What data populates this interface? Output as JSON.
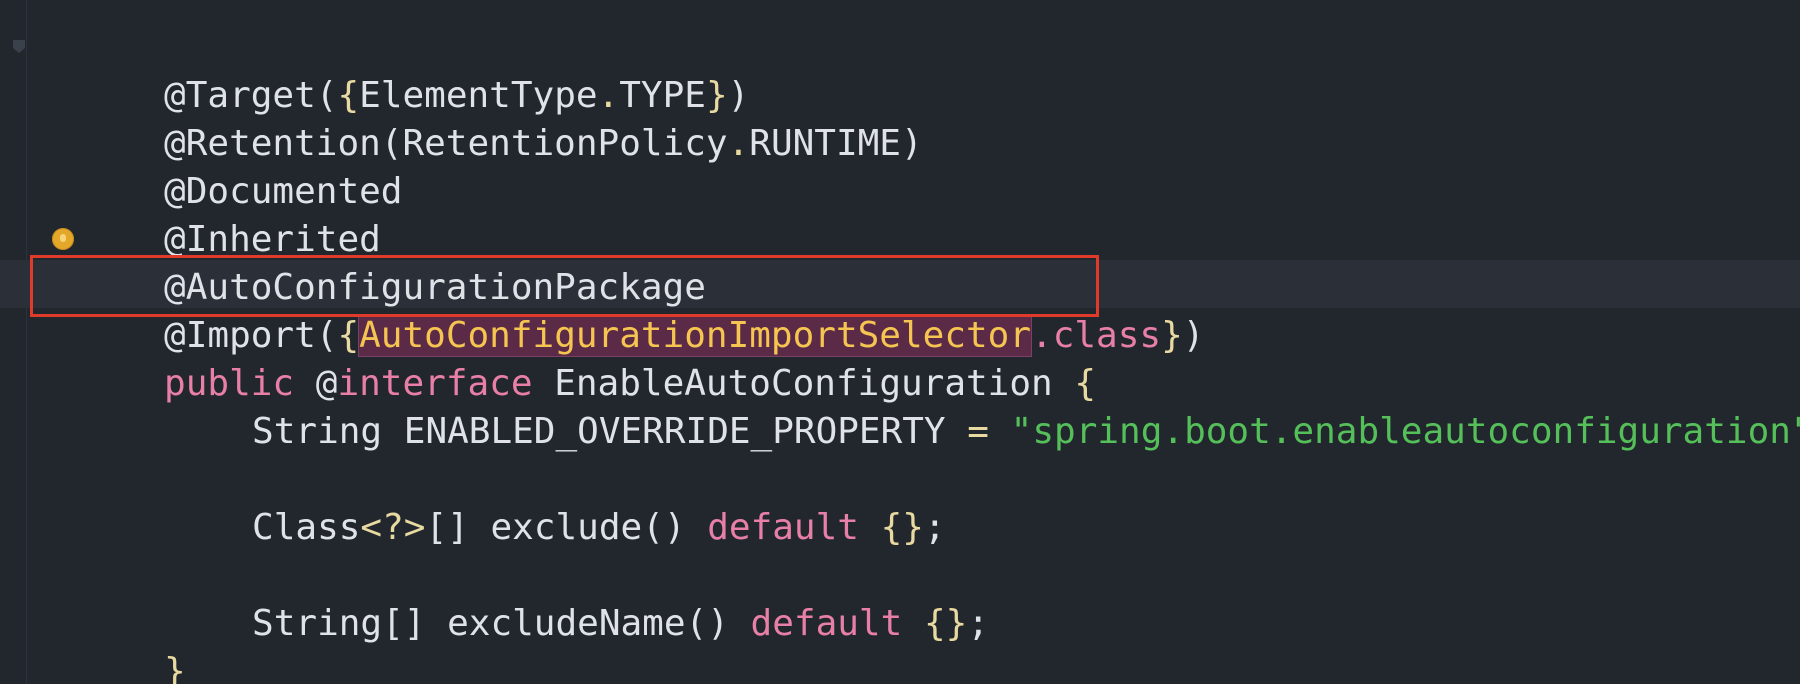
{
  "editor": {
    "lines": [
      {
        "parts": [
          "@Target(",
          "{",
          "ElementType",
          ".",
          "TYPE",
          "}",
          ")"
        ]
      },
      {
        "parts": [
          "@Retention(RetentionPolicy",
          ".",
          "RUNTIME)"
        ]
      },
      {
        "parts": [
          "@Documented"
        ]
      },
      {
        "parts": [
          "@Inherited"
        ]
      },
      {
        "parts": [
          "@AutoConfigurationPackage"
        ]
      },
      {
        "parts": [
          "@Import(",
          "{",
          "AutoConfigurationImportSelector",
          ".class",
          "}",
          ")"
        ]
      },
      {
        "parts": [
          "public",
          " @",
          "interface",
          " EnableAutoConfiguration ",
          "{"
        ]
      },
      {
        "parts": [
          "String ENABLED_OVERRIDE_PROPERTY ",
          "=",
          " ",
          "\"spring.boot.enableautoconfiguration\"",
          ";"
        ]
      },
      {
        "parts": [
          ""
        ]
      },
      {
        "parts": [
          "Class",
          "<?>",
          "[] exclude() ",
          "default",
          " ",
          "{}",
          ";"
        ]
      },
      {
        "parts": [
          ""
        ]
      },
      {
        "parts": [
          "String[] excludeName() ",
          "default",
          " ",
          "{}",
          ";"
        ]
      },
      {
        "parts": [
          "}"
        ]
      }
    ]
  },
  "colors": {
    "background": "#22272e",
    "keyword": "#e87fa6",
    "string": "#55c05a",
    "highlight_box": "#e03a2a"
  },
  "icons": {
    "fold_top": "fold-icon",
    "fold_bottom": "fold-icon",
    "intention": "lightbulb-icon"
  }
}
